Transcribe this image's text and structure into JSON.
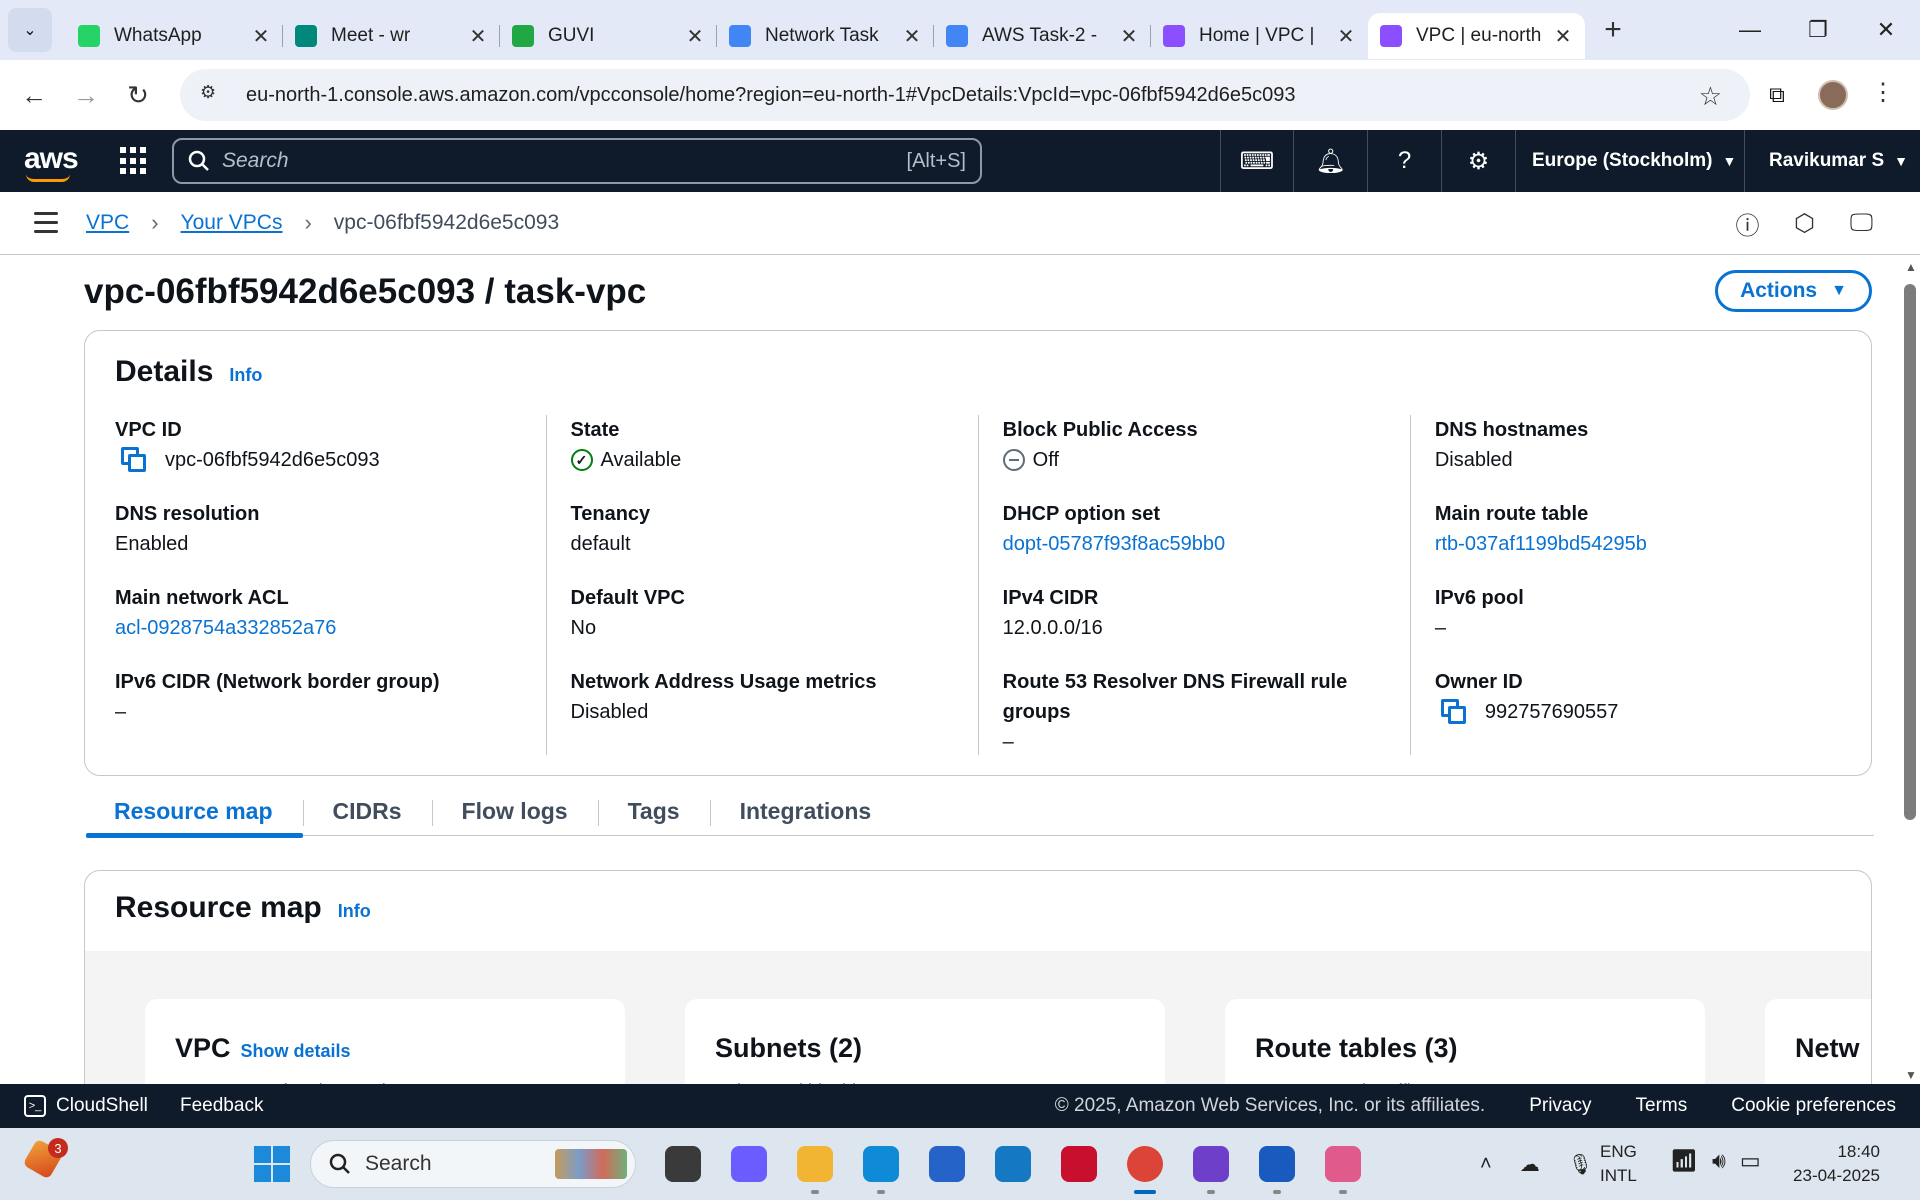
{
  "browser": {
    "tabs": [
      {
        "title": "WhatsApp",
        "icon": "whatsapp-icon",
        "color": "#25d366"
      },
      {
        "title": "Meet - wr",
        "icon": "meet-icon",
        "color": "#00897b"
      },
      {
        "title": "GUVI",
        "icon": "guvi-icon",
        "color": "#22a745"
      },
      {
        "title": "Network Task",
        "icon": "docs-icon",
        "color": "#4285f4"
      },
      {
        "title": "AWS Task-2 -",
        "icon": "docs-icon",
        "color": "#4285f4"
      },
      {
        "title": "Home | VPC |",
        "icon": "vpc-icon",
        "color": "#8c4fff"
      },
      {
        "title": "VPC | eu-north",
        "icon": "vpc-icon",
        "color": "#8c4fff"
      }
    ],
    "active_tab": 6,
    "url": "eu-north-1.console.aws.amazon.com/vpcconsole/home?region=eu-north-1#VpcDetails:VpcId=vpc-06fbf5942d6e5c093"
  },
  "aws_nav": {
    "logo": "aws",
    "search_placeholder": "Search",
    "search_shortcut": "[Alt+S]",
    "region": "Europe (Stockholm)",
    "user": "Ravikumar S"
  },
  "breadcrumb": {
    "items": [
      "VPC",
      "Your VPCs"
    ],
    "current": "vpc-06fbf5942d6e5c093"
  },
  "page": {
    "title": "vpc-06fbf5942d6e5c093 / task-vpc",
    "actions_label": "Actions"
  },
  "details": {
    "heading": "Details",
    "info": "Info",
    "vpc_id_label": "VPC ID",
    "vpc_id": "vpc-06fbf5942d6e5c093",
    "dns_resolution_label": "DNS resolution",
    "dns_resolution": "Enabled",
    "main_acl_label": "Main network ACL",
    "main_acl": "acl-0928754a332852a76",
    "ipv6_cidr_label": "IPv6 CIDR (Network border group)",
    "ipv6_cidr": "–",
    "state_label": "State",
    "state": "Available",
    "tenancy_label": "Tenancy",
    "tenancy": "default",
    "default_vpc_label": "Default VPC",
    "default_vpc": "No",
    "nau_metrics_label": "Network Address Usage metrics",
    "nau_metrics": "Disabled",
    "bpa_label": "Block Public Access",
    "bpa": "Off",
    "dhcp_label": "DHCP option set",
    "dhcp": "dopt-05787f93f8ac59bb0",
    "ipv4_cidr_label": "IPv4 CIDR",
    "ipv4_cidr": "12.0.0.0/16",
    "r53_label": "Route 53 Resolver DNS Firewall rule groups",
    "r53": "–",
    "dns_hostnames_label": "DNS hostnames",
    "dns_hostnames": "Disabled",
    "main_rt_label": "Main route table",
    "main_rt": "rtb-037af1199bd54295b",
    "ipv6_pool_label": "IPv6 pool",
    "ipv6_pool": "–",
    "owner_label": "Owner ID",
    "owner": "992757690557"
  },
  "content_tabs": [
    "Resource map",
    "CIDRs",
    "Flow logs",
    "Tags",
    "Integrations"
  ],
  "active_content_tab": 0,
  "resource_map": {
    "heading": "Resource map",
    "info": "Info",
    "boxes": [
      {
        "title": "VPC",
        "extra": "Show details",
        "desc": "Your AWS virtual network"
      },
      {
        "title": "Subnets (2)",
        "extra": "",
        "desc": "Subnets within this VPC"
      },
      {
        "title": "Route tables (3)",
        "extra": "",
        "desc": "Route network traffic to resources"
      },
      {
        "title": "Netw",
        "extra": "",
        "desc": "Connect"
      }
    ]
  },
  "footer": {
    "cloudshell": "CloudShell",
    "feedback": "Feedback",
    "copyright": "© 2025, Amazon Web Services, Inc. or its affiliates.",
    "privacy": "Privacy",
    "terms": "Terms",
    "cookies": "Cookie preferences"
  },
  "taskbar": {
    "weather_badge": "3",
    "search_placeholder": "Search",
    "lang_line1": "ENG",
    "lang_line2": "INTL",
    "time": "18:40",
    "date": "23-04-2025",
    "apps": [
      {
        "name": "task-view",
        "color": "#3a3a3a"
      },
      {
        "name": "copilot",
        "color": "#6a5cff"
      },
      {
        "name": "file-explorer",
        "color": "#f2b533"
      },
      {
        "name": "edge",
        "color": "#0f8ad6"
      },
      {
        "name": "store",
        "color": "#2563c9"
      },
      {
        "name": "dell",
        "color": "#1479c2"
      },
      {
        "name": "mcafee",
        "color": "#c8102e"
      },
      {
        "name": "chrome",
        "color": "#db4437"
      },
      {
        "name": "github-desktop",
        "color": "#6e40c9"
      },
      {
        "name": "word",
        "color": "#185abd"
      },
      {
        "name": "snipping-tool",
        "color": "#e05a8c"
      }
    ]
  }
}
